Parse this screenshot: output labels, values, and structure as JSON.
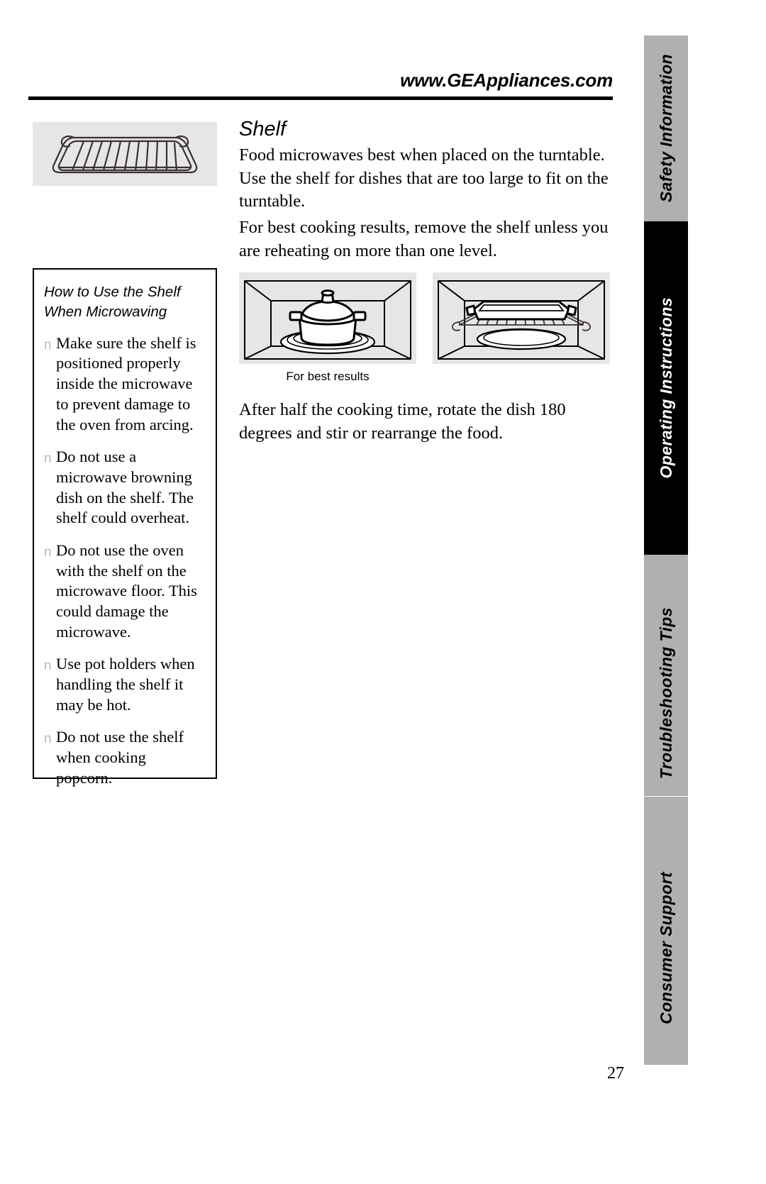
{
  "header": {
    "site_url": "www.GEAppliances.com"
  },
  "main": {
    "heading": "Shelf",
    "paragraphs": [
      "Food microwaves best when placed on the turntable. Use the shelf for dishes that are too large to fit on the turntable.",
      "For best cooking results, remove the shelf unless you are reheating on more than one level.",
      "After half the cooking time, rotate the dish 180 degrees and stir or rearrange the food."
    ],
    "figure_caption": "For best results",
    "figures": [
      {
        "name": "covered-pot-on-turntable",
        "caption": "For best results"
      },
      {
        "name": "baking-dish-on-shelf",
        "caption": ""
      }
    ]
  },
  "shelf_figure": {
    "name": "wire-shelf-illustration"
  },
  "tipbox": {
    "title": "How to Use the Shelf When Microwaving",
    "title_line_1": "How to Use the Shelf",
    "title_line_2": "When Microwaving",
    "bullet_glyph": "n",
    "items": [
      "Make sure the shelf is positioned properly inside the microwave to prevent damage to the oven from arcing.",
      "Do not use a microwave browning dish on the shelf. The shelf could overheat.",
      "Do not use the oven with the shelf on the microwave floor. This could damage the microwave.",
      "Use pot holders when handling the shelf  it may be hot.",
      "Do not use the shelf when cooking popcorn."
    ]
  },
  "sidebar": {
    "tabs": [
      {
        "label": "Safety Information",
        "active": false
      },
      {
        "label": "Operating Instructions",
        "active": true
      },
      {
        "label": "Troubleshooting Tips",
        "active": false
      },
      {
        "label": "Consumer Support",
        "active": false
      }
    ]
  },
  "footer": {
    "page_number": "27"
  },
  "colors": {
    "active_tab_bg": "#000000",
    "active_tab_text": "#ffffff",
    "inactive_tab_bg": "#b0b0b0",
    "figure_bg": "#e6e6e6",
    "bullet": "#b9b9b9",
    "text": "#000000"
  }
}
